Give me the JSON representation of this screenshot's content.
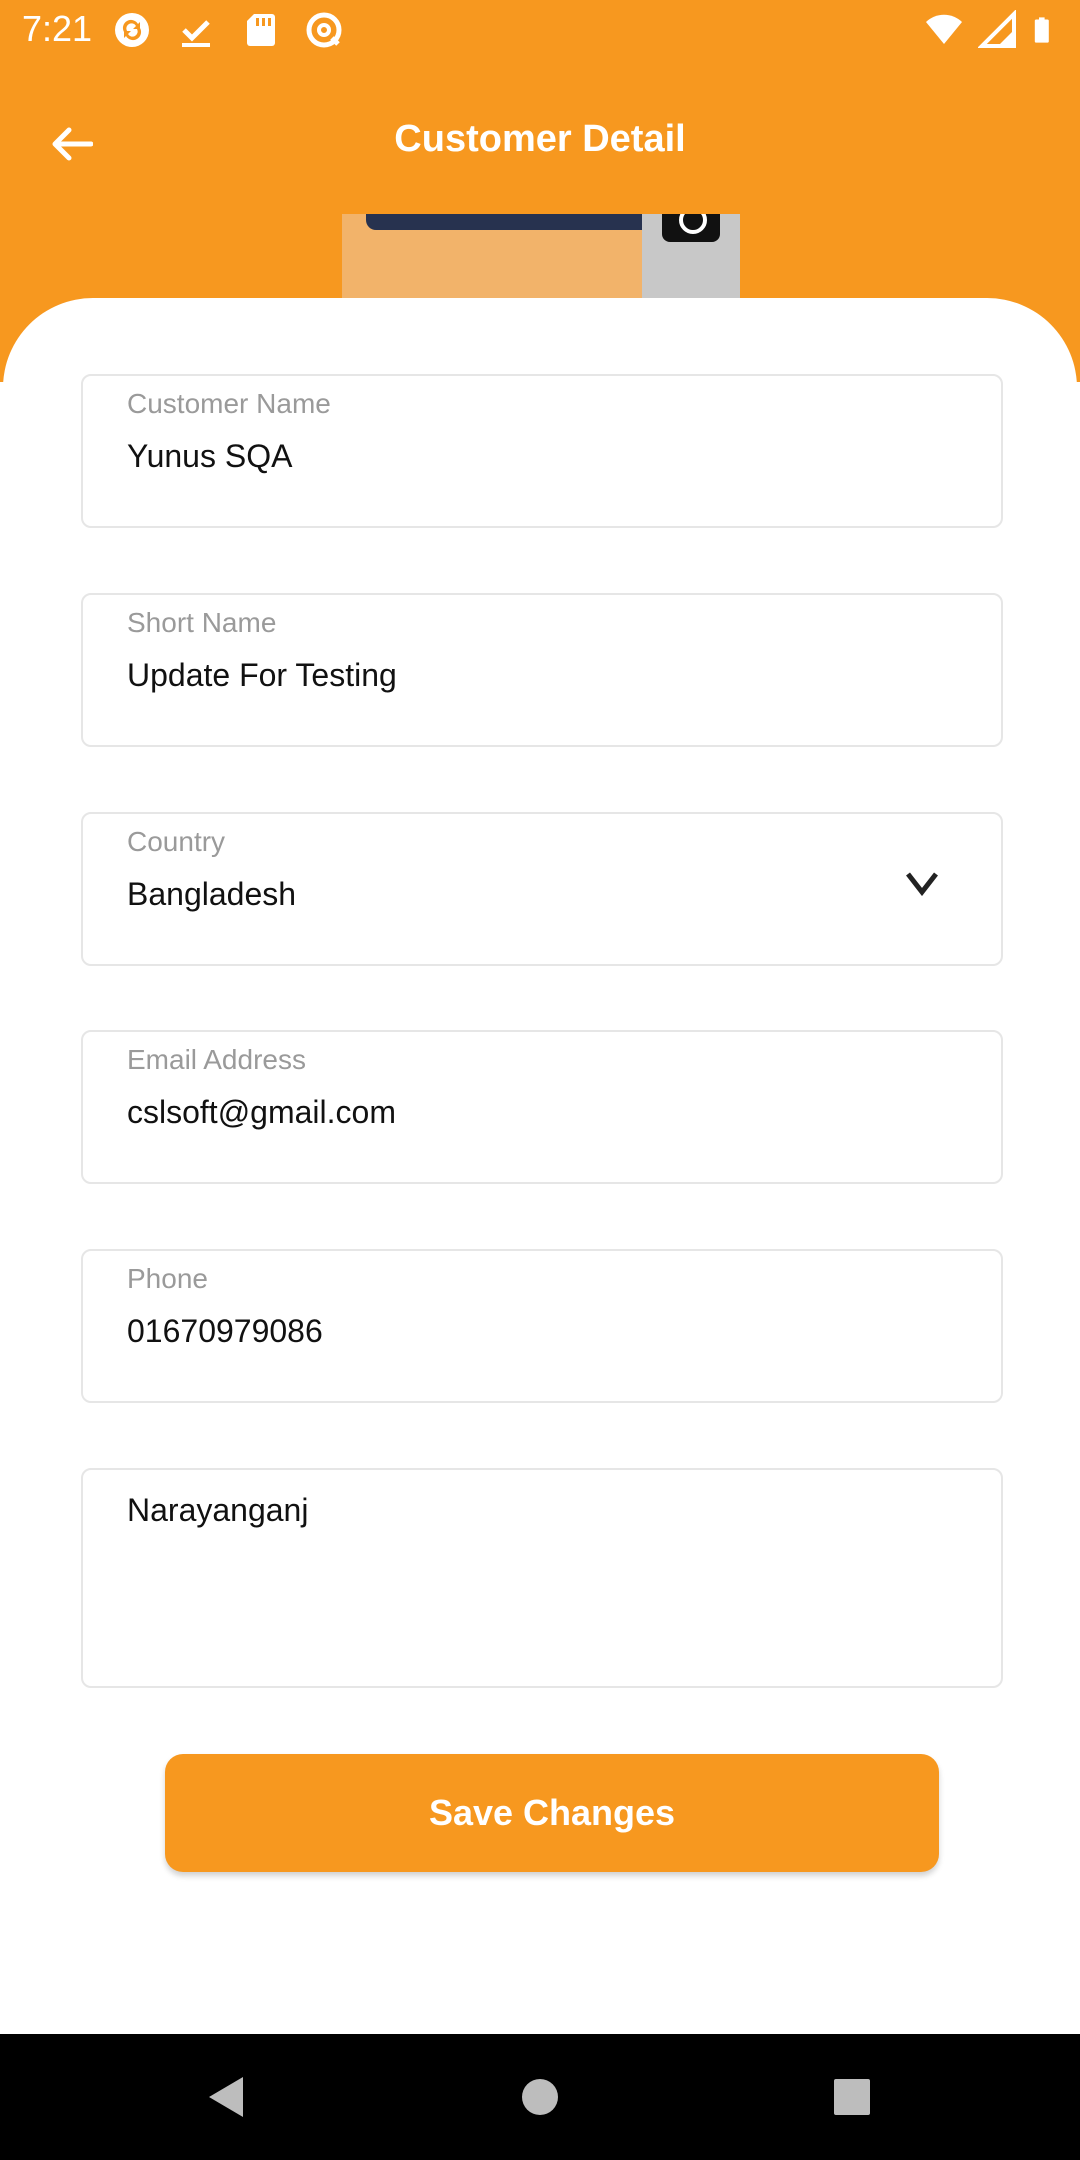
{
  "status_bar": {
    "time": "7:21",
    "left_icons": [
      "sync-icon",
      "download-done-icon",
      "sd-card-icon",
      "at-sign-icon"
    ],
    "right_icons": [
      "wifi-icon",
      "cell-signal-icon",
      "battery-icon"
    ]
  },
  "header": {
    "title": "Customer Detail",
    "background": "#F7981F"
  },
  "form": {
    "customer_name": {
      "label": "Customer Name",
      "value": "Yunus SQA"
    },
    "short_name": {
      "label": "Short Name",
      "value": "Update For Testing"
    },
    "country": {
      "label": "Country",
      "value": "Bangladesh"
    },
    "email": {
      "label": "Email Address",
      "value": "cslsoft@gmail.com"
    },
    "phone": {
      "label": "Phone",
      "value": "01670979086"
    },
    "address": {
      "value": "Narayanganj"
    }
  },
  "actions": {
    "save_label": "Save Changes"
  },
  "nav_bar": {
    "buttons": [
      "back-triangle-icon",
      "home-circle-icon",
      "recents-square-icon"
    ]
  },
  "colors": {
    "accent": "#F7981F",
    "field_border": "#E6E6E6",
    "label": "#9A9A9A"
  }
}
